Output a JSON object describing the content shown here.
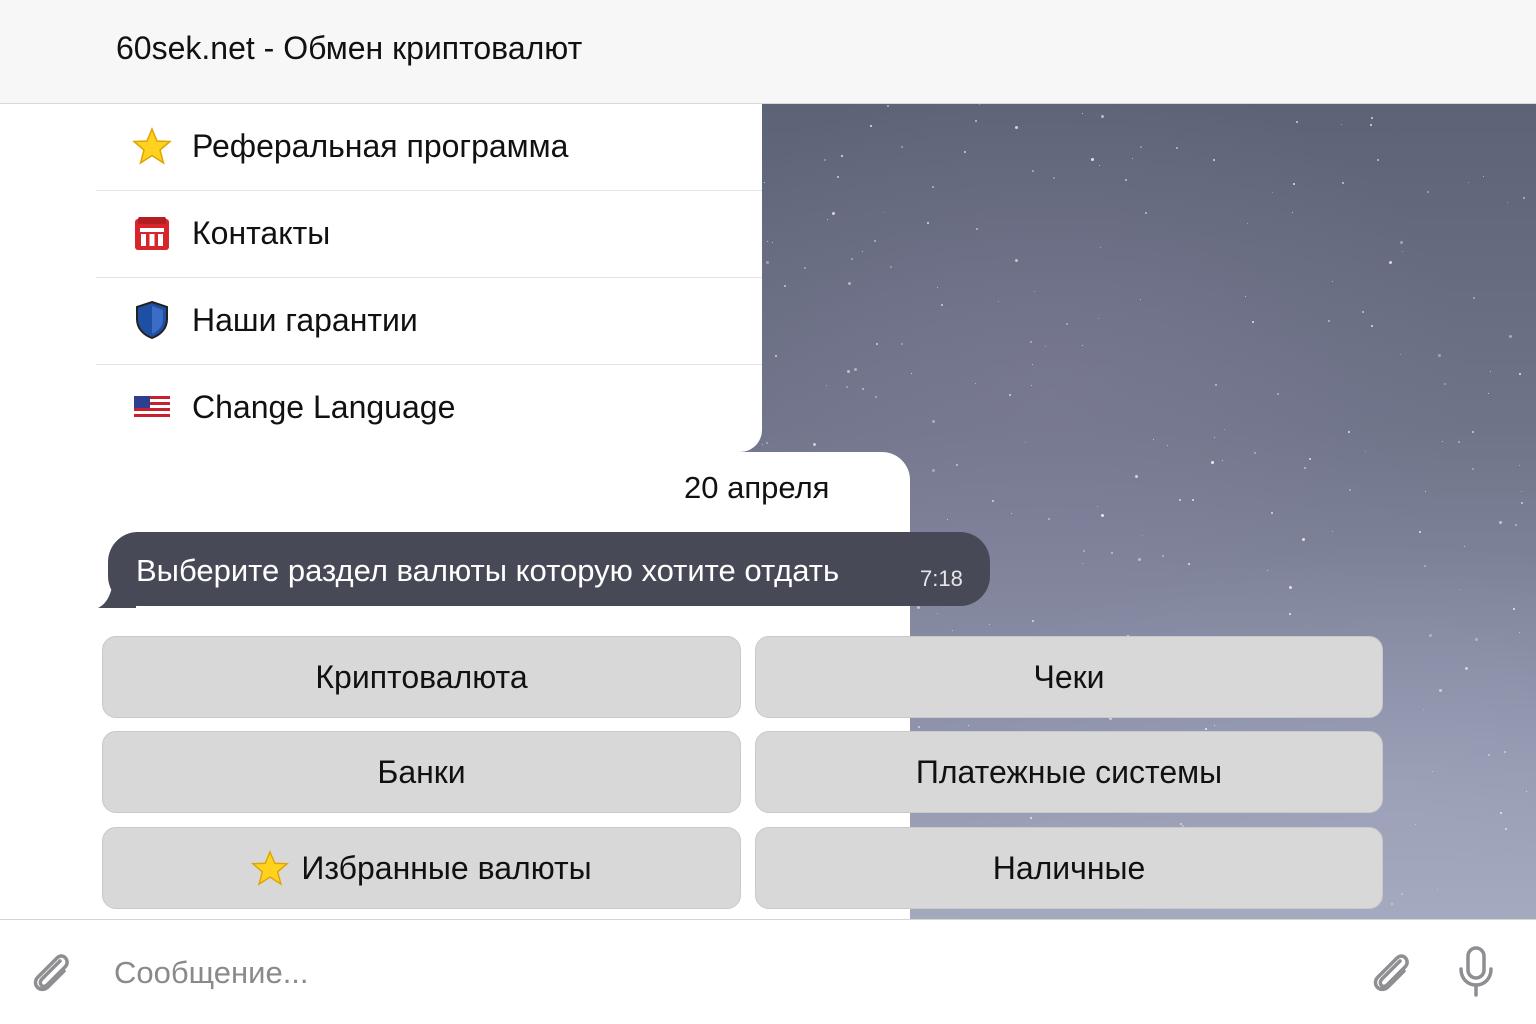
{
  "header": {
    "title": "60sek.net - Обмен криптовалют"
  },
  "menu": {
    "items": [
      {
        "icon": "star-icon",
        "label": "Реферальная программа"
      },
      {
        "icon": "building-icon",
        "label": "Контакты"
      },
      {
        "icon": "shield-icon",
        "label": "Наши гарантии"
      },
      {
        "icon": "us-flag-icon",
        "label": "Change Language"
      }
    ]
  },
  "chat": {
    "date": "20 апреля",
    "message": {
      "text": "Выберите раздел валюты которую хотите отдать",
      "time": "7:18"
    }
  },
  "keyboard": {
    "buttons": [
      {
        "label": "Криптовалюта"
      },
      {
        "label": "Чеки"
      },
      {
        "label": "Банки"
      },
      {
        "label": "Платежные системы"
      },
      {
        "label": "Избранные валюты",
        "icon": "star-icon"
      },
      {
        "label": "Наличные"
      }
    ]
  },
  "input": {
    "placeholder": "Сообщение...",
    "value": ""
  },
  "icons": {
    "attach_left": "paperclip-icon",
    "attach_right": "paperclip-icon",
    "mic": "microphone-icon"
  },
  "colors": {
    "bubble": "#474a56",
    "button": "#d8d8d8",
    "header": "#f7f7f7"
  }
}
